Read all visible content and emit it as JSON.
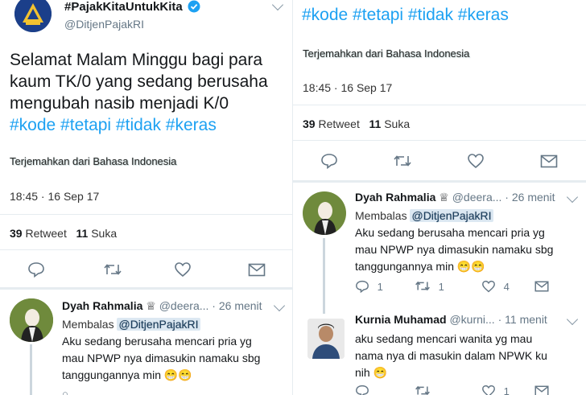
{
  "tweet": {
    "account_name": "#PajakKitaUntukKita",
    "handle": "@DitjenPajakRI",
    "text_lines": [
      "Selamat Malam Minggu bagi para",
      "kaum TK/0 yang sedang berusaha",
      "mengubah nasib menjadi K/0"
    ],
    "hashtags": "#kode #tetapi #tidak #keras",
    "translate": "Terjemahkan dari Bahasa Indonesia",
    "time": "18:45 · 16 Sep 17",
    "retweet_count": "39",
    "retweet_label": "Retweet",
    "like_count": "11",
    "like_label": "Suka"
  },
  "replies": [
    {
      "name": "Dyah Rahmalia",
      "badge": "♕",
      "handle": "@deera...",
      "time": "26 menit",
      "replying_label": "Membalas",
      "replying_to": "@DitjenPajakRI",
      "lines": [
        "Aku sedang berusaha mencari pria yg",
        "mau NPWP nya dimasukin namaku sbg",
        "tanggungannya min 😁😁"
      ],
      "reply_count": "1",
      "retweet_count": "1",
      "like_count": "4"
    },
    {
      "name": "Kurnia Muhamad",
      "handle": "@kurni...",
      "time": "11 menit",
      "lines": [
        "aku sedang mencari wanita yg mau",
        "nama nya di masukin dalam NPWK ku",
        "nih 😁"
      ],
      "retweet_count": "1",
      "like_count": "1"
    }
  ],
  "colors": {
    "link": "#1da1f2",
    "muted": "#657786",
    "divider": "#e6ecf0",
    "verified": "#1da1f2"
  }
}
